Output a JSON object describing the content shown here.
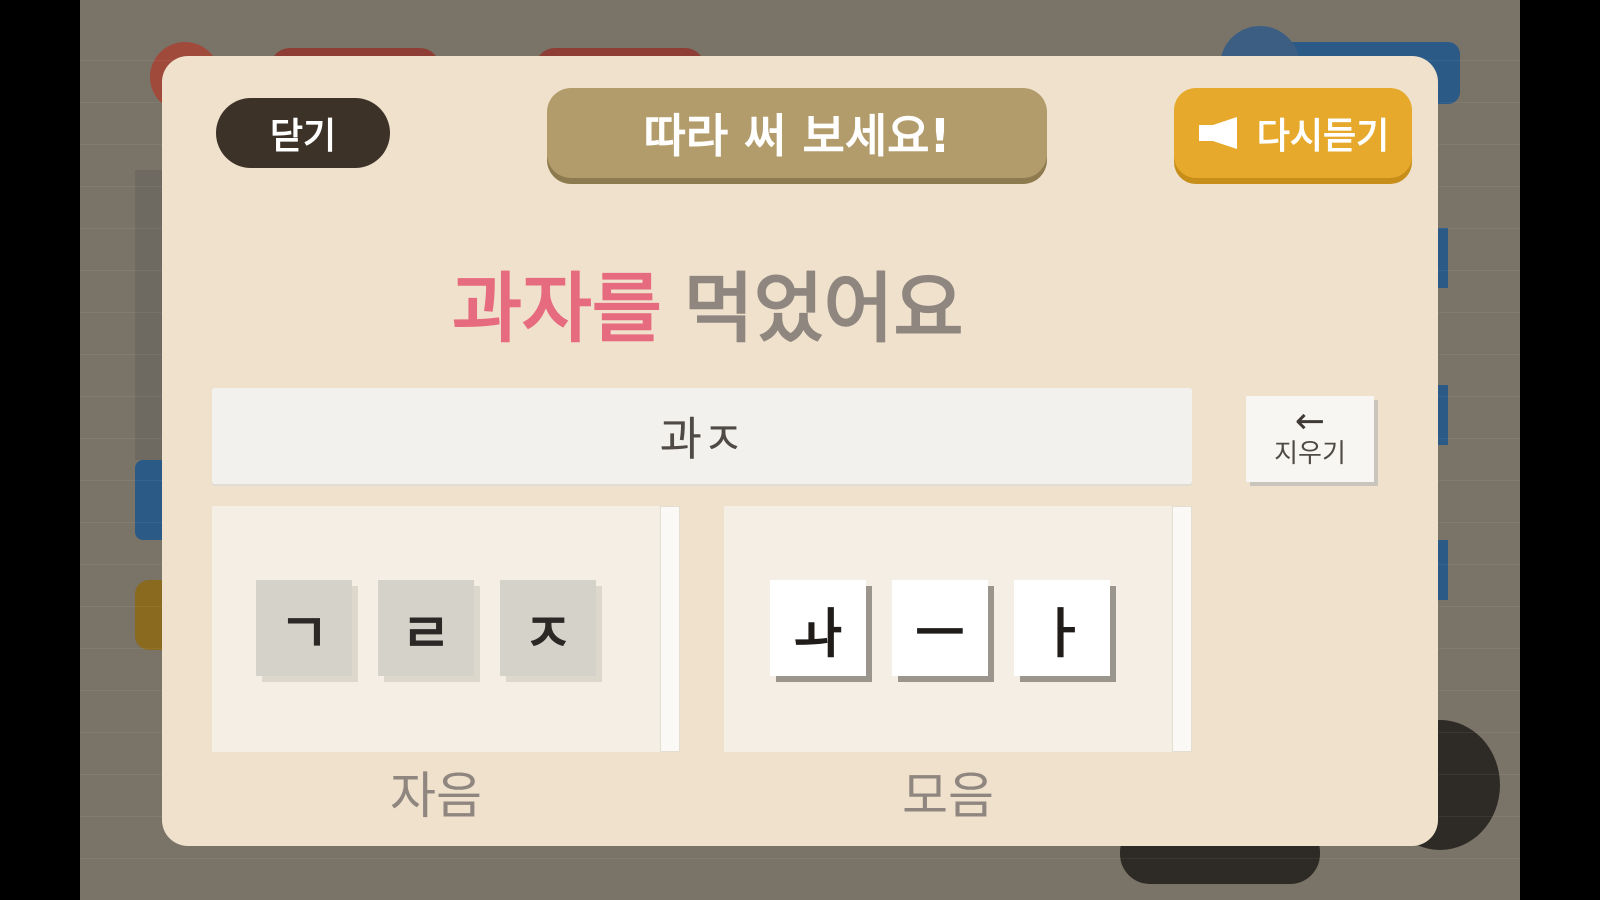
{
  "modal": {
    "close_label": "닫기",
    "title": "따라 써 보세요!",
    "replay_label": "다시듣기",
    "sentence": {
      "highlight": "과자를",
      "rest": "먹었어요"
    },
    "answer_value": "과ㅈ",
    "erase": {
      "arrow": "←",
      "label": "지우기"
    },
    "consonants": {
      "label": "자음",
      "keys": [
        "ㄱ",
        "ㄹ",
        "ㅈ"
      ]
    },
    "vowels": {
      "label": "모음",
      "keys": [
        "ㅘ",
        "ㅡ",
        "ㅏ"
      ]
    }
  },
  "colors": {
    "modal_bg": "#efe1cb",
    "highlight": "#e76b7e",
    "replay": "#e6a92c",
    "title_banner": "#b39c6b",
    "close": "#3d3228"
  },
  "icons": {
    "replay": "speaker-icon",
    "erase": "backspace-arrow-icon"
  }
}
